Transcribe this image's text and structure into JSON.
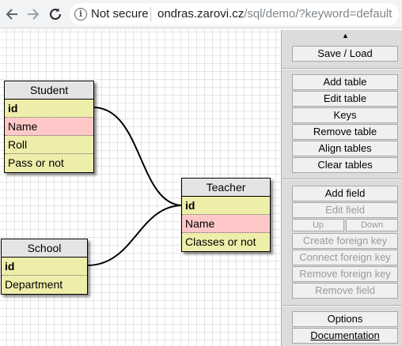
{
  "browser": {
    "security_label": "Not secure",
    "url_host": "ondras.zarovi.cz",
    "url_path": "/sql/demo/?keyword=default"
  },
  "tables": {
    "student": {
      "title": "Student",
      "rows": [
        "id",
        "Name",
        "Roll",
        "Pass or not"
      ]
    },
    "teacher": {
      "title": "Teacher",
      "rows": [
        "id",
        "Name",
        "Classes or not"
      ]
    },
    "school": {
      "title": "School",
      "rows": [
        "id",
        "Department"
      ]
    }
  },
  "panel": {
    "collapse_glyph": "▲",
    "save_load": "Save / Load",
    "add_table": "Add table",
    "edit_table": "Edit table",
    "keys": "Keys",
    "remove_table": "Remove table",
    "align_tables": "Align tables",
    "clear_tables": "Clear tables",
    "add_field": "Add field",
    "edit_field": "Edit field",
    "up": "Up",
    "down": "Down",
    "create_fk": "Create foreign key",
    "connect_fk": "Connect foreign key",
    "remove_fk": "Remove foreign key",
    "remove_field": "Remove field",
    "options": "Options",
    "documentation": "Documentation"
  },
  "colors": {
    "table_body": "#eeeeaa",
    "foreign_key_row": "#ffc8c8",
    "table_header": "#e4e4e4",
    "panel_bg": "#dcdcdc"
  }
}
